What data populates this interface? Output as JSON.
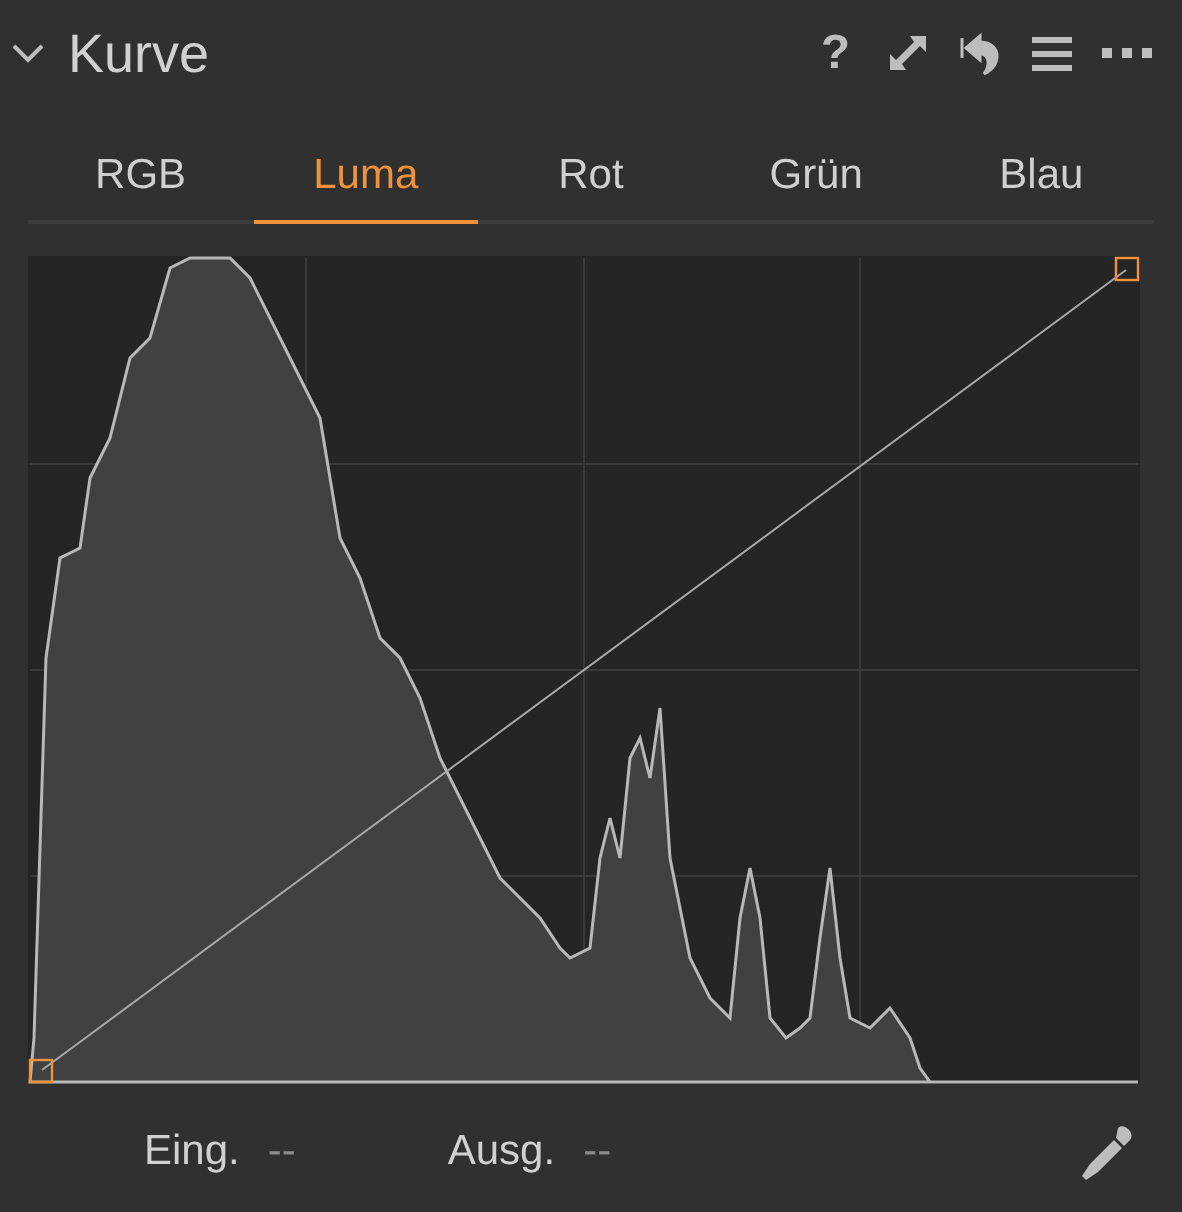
{
  "panel": {
    "title": "Kurve",
    "expanded": true
  },
  "tabs": [
    {
      "label": "RGB",
      "selected": false
    },
    {
      "label": "Luma",
      "selected": true
    },
    {
      "label": "Rot",
      "selected": false
    },
    {
      "label": "Grün",
      "selected": false
    },
    {
      "label": "Blau",
      "selected": false
    }
  ],
  "help_icon": "?",
  "readouts": [
    {
      "label": "Eing.",
      "value": "--"
    },
    {
      "label": "Ausg.",
      "value": "--"
    }
  ]
}
